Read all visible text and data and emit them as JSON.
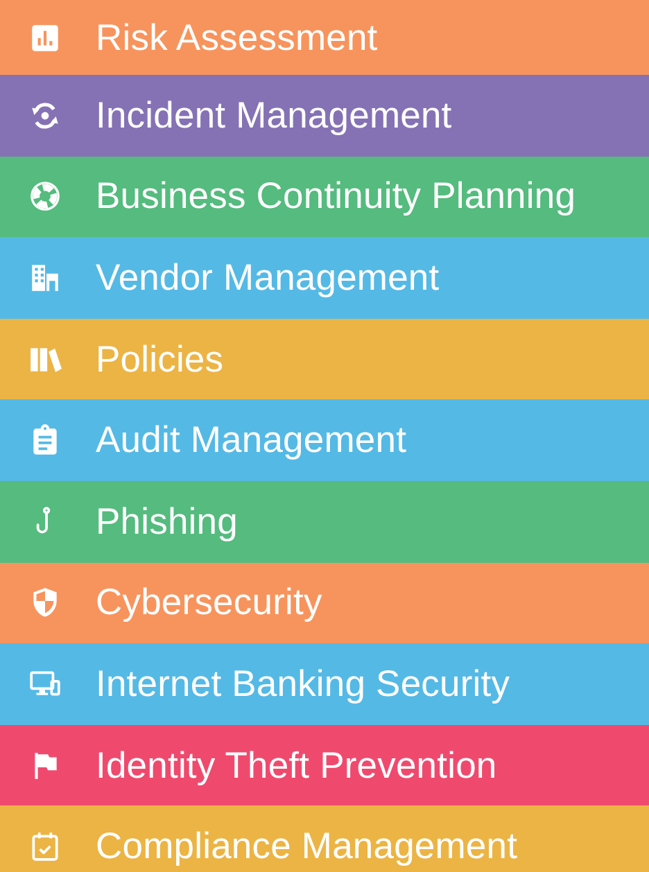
{
  "menu": [
    {
      "label": "Risk Assessment",
      "color": "#f7945d"
    },
    {
      "label": "Incident Management",
      "color": "#8572b5"
    },
    {
      "label": "Business Continuity Planning",
      "color": "#55bb7e"
    },
    {
      "label": "Vendor Management",
      "color": "#55b9e5"
    },
    {
      "label": "Policies",
      "color": "#ecb445"
    },
    {
      "label": "Audit Management",
      "color": "#55b9e5"
    },
    {
      "label": "Phishing",
      "color": "#55bb7e"
    },
    {
      "label": "Cybersecurity",
      "color": "#f7945d"
    },
    {
      "label": "Internet Banking Security",
      "color": "#55b9e5"
    },
    {
      "label": "Identity Theft Prevention",
      "color": "#ef4a6e"
    },
    {
      "label": "Compliance Management",
      "color": "#ecb445"
    }
  ]
}
